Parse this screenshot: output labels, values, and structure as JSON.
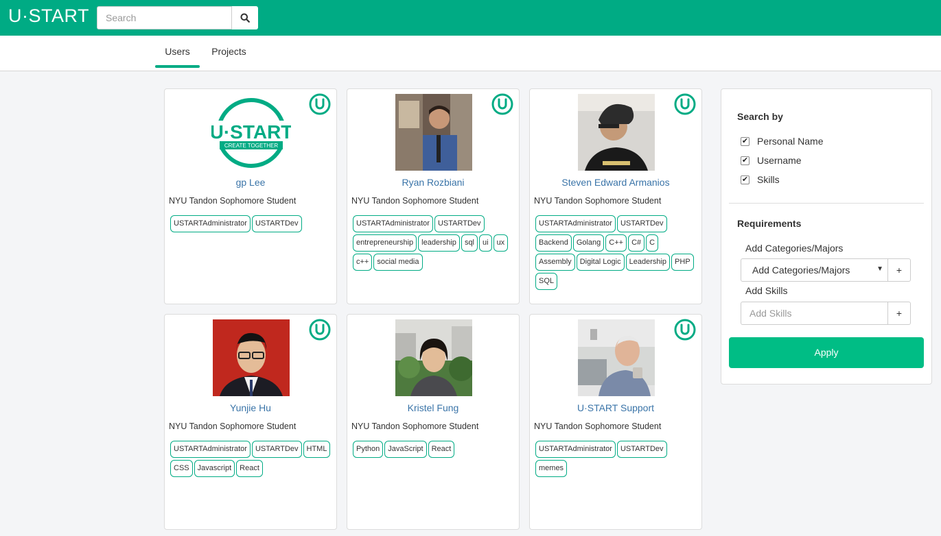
{
  "header": {
    "brand": "U·START",
    "search_placeholder": "Search",
    "search_icon": "search-icon"
  },
  "tabs": [
    {
      "label": "Users",
      "active": true
    },
    {
      "label": "Projects",
      "active": false
    }
  ],
  "cards": [
    {
      "name": "gp Lee",
      "subtitle": "NYU Tandon Sophomore Student",
      "photo": "ustart-logo",
      "logo_text": "U·START",
      "logo_sub": "CREATE TOGETHER",
      "tags": [
        "USTARTAdministrator",
        "USTARTDev"
      ]
    },
    {
      "name": "Ryan Rozbiani",
      "subtitle": "NYU Tandon Sophomore Student",
      "photo": "profile-photo",
      "tags": [
        "USTARTAdministrator",
        "USTARTDev",
        "entrepreneurship",
        "leadership",
        "sql",
        "ui",
        "ux",
        "c++",
        "social media"
      ]
    },
    {
      "name": "Steven Edward Armanios",
      "subtitle": "NYU Tandon Sophomore Student",
      "photo": "profile-photo",
      "tags": [
        "USTARTAdministrator",
        "USTARTDev",
        "Backend",
        "Golang",
        "C++",
        "C#",
        "C",
        "Assembly",
        "Digital Logic",
        "Leadership",
        "PHP",
        "SQL"
      ]
    },
    {
      "name": "Yunjie Hu",
      "subtitle": "NYU Tandon Sophomore Student",
      "photo": "profile-photo",
      "tags": [
        "USTARTAdministrator",
        "USTARTDev",
        "HTML",
        "CSS",
        "Javascript",
        "React"
      ]
    },
    {
      "name": "Kristel Fung",
      "subtitle": "NYU Tandon Sophomore Student",
      "photo": "profile-photo",
      "tags": [
        "Python",
        "JavaScript",
        "React"
      ]
    },
    {
      "name": "U·START Support",
      "subtitle": "NYU Tandon Sophomore Student",
      "photo": "profile-photo",
      "tags": [
        "USTARTAdministrator",
        "USTARTDev",
        "memes"
      ]
    }
  ],
  "sidebar": {
    "search_by_title": "Search by",
    "checkboxes": [
      {
        "label": "Personal Name",
        "checked": true
      },
      {
        "label": "Username",
        "checked": true
      },
      {
        "label": "Skills",
        "checked": true
      }
    ],
    "requirements_title": "Requirements",
    "categories_label": "Add Categories/Majors",
    "categories_select": "Add Categories/Majors",
    "skills_label": "Add Skills",
    "skills_placeholder": "Add Skills",
    "plus": "+",
    "apply_label": "Apply"
  },
  "colors": {
    "brand": "#00ab84",
    "apply": "#00bd85",
    "link": "#3a74a8"
  }
}
